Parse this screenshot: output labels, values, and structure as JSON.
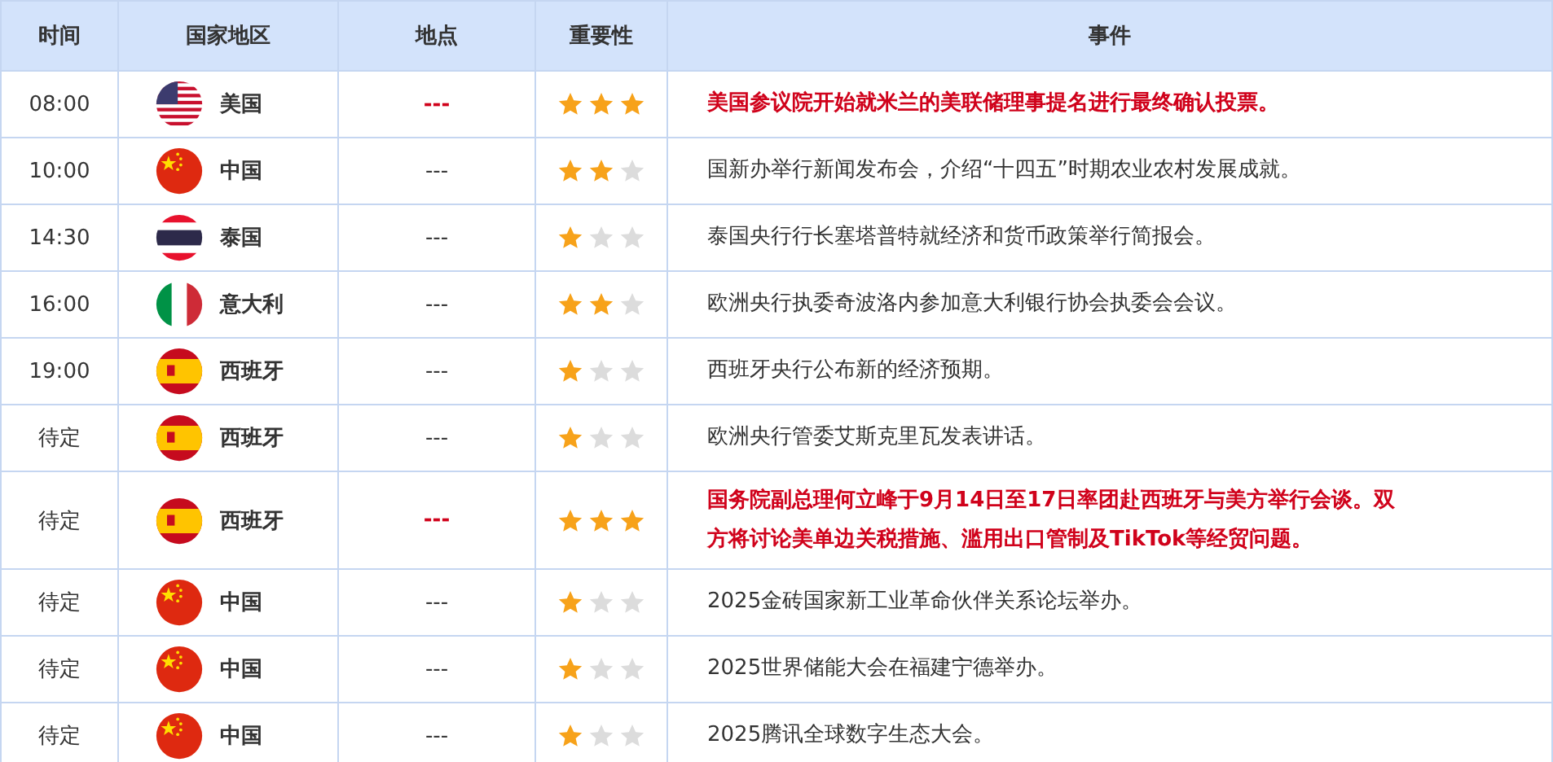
{
  "table": {
    "columns": [
      "时间",
      "国家地区",
      "地点",
      "重要性",
      "事件"
    ],
    "rows": [
      {
        "time": "08:00",
        "kind": "us",
        "country": "美国",
        "location": "---",
        "stars": 3,
        "highlighted": true,
        "event": "美国参议院开始就米兰的美联储理事提名进行最终确认投票。"
      },
      {
        "time": "10:00",
        "kind": "cn",
        "country": "中国",
        "location": "---",
        "stars": 2,
        "highlighted": false,
        "event": "国新办举行新闻发布会，介绍“十四五”时期农业农村发展成就。"
      },
      {
        "time": "14:30",
        "kind": "th",
        "country": "泰国",
        "location": "---",
        "stars": 1,
        "highlighted": false,
        "event": "泰国央行行长塞塔普特就经济和货币政策举行简报会。"
      },
      {
        "time": "16:00",
        "kind": "it",
        "country": "意大利",
        "location": "---",
        "stars": 2,
        "highlighted": false,
        "event": "欧洲央行执委奇波洛内参加意大利银行协会执委会会议。"
      },
      {
        "time": "19:00",
        "kind": "es",
        "country": "西班牙",
        "location": "---",
        "stars": 1,
        "highlighted": false,
        "event": "西班牙央行公布新的经济预期。"
      },
      {
        "time": "待定",
        "kind": "es",
        "country": "西班牙",
        "location": "---",
        "stars": 1,
        "highlighted": false,
        "event": "欧洲央行管委艾斯克里瓦发表讲话。"
      },
      {
        "time": "待定",
        "kind": "es",
        "country": "西班牙",
        "location": "---",
        "stars": 3,
        "highlighted": true,
        "event": "国务院副总理何立峰于9月14日至17日率团赴西班牙与美方举行会谈。双方将讨论美单边关税措施、滥用出口管制及TikTok等经贸问题。"
      },
      {
        "time": "待定",
        "kind": "cn",
        "country": "中国",
        "location": "---",
        "stars": 1,
        "highlighted": false,
        "event": "2025金砖国家新工业革命伙伴关系论坛举办。"
      },
      {
        "time": "待定",
        "kind": "cn",
        "country": "中国",
        "location": "---",
        "stars": 1,
        "highlighted": false,
        "event": "2025世界储能大会在福建宁德举办。"
      },
      {
        "time": "待定",
        "kind": "cn",
        "country": "中国",
        "location": "---",
        "stars": 1,
        "highlighted": false,
        "event": "2025腾讯全球数字生态大会。"
      }
    ]
  }
}
